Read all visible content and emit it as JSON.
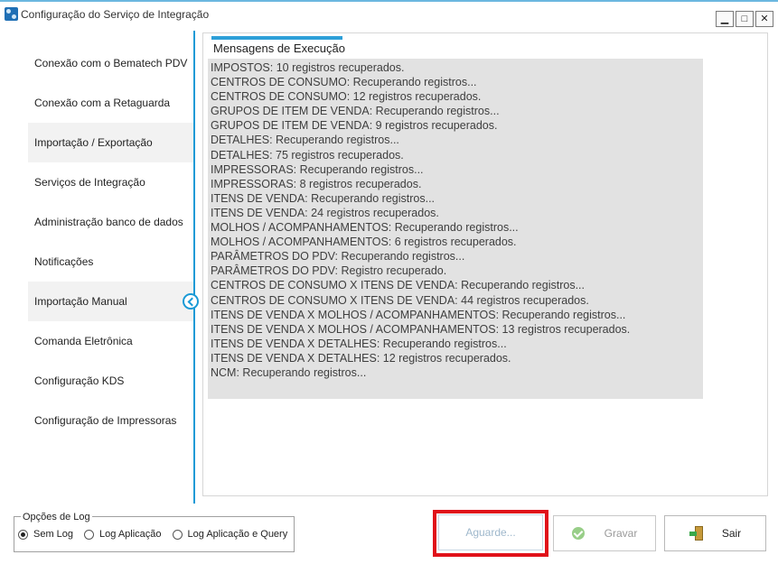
{
  "window": {
    "title": "Configuração do Serviço de Integração",
    "buttons": {
      "minimize": "▁",
      "maximize": "□",
      "close": "✕"
    }
  },
  "sidebar": {
    "items": [
      {
        "label": "Conexão com o Bematech PDV",
        "active": false
      },
      {
        "label": "Conexão com a Retaguarda",
        "active": false
      },
      {
        "label": "Importação / Exportação",
        "active": true
      },
      {
        "label": "Serviços de Integração",
        "active": false
      },
      {
        "label": "Administração banco de dados",
        "active": false
      },
      {
        "label": "Notificações",
        "active": false
      },
      {
        "label": "Importação Manual",
        "active": true
      },
      {
        "label": "Comanda Eletrônica",
        "active": false
      },
      {
        "label": "Configuração KDS",
        "active": false
      },
      {
        "label": "Configuração de Impressoras",
        "active": false
      }
    ]
  },
  "main": {
    "group_title": "Mensagens de Execução",
    "log_lines": [
      "IMPOSTOS: 10 registros recuperados.",
      "CENTROS DE CONSUMO: Recuperando registros...",
      "CENTROS DE CONSUMO: 12 registros recuperados.",
      "GRUPOS DE ITEM DE VENDA: Recuperando registros...",
      "GRUPOS DE ITEM DE VENDA: 9 registros recuperados.",
      "DETALHES: Recuperando registros...",
      "DETALHES: 75 registros recuperados.",
      "IMPRESSORAS: Recuperando registros...",
      "IMPRESSORAS: 8 registros recuperados.",
      "ITENS DE VENDA: Recuperando registros...",
      "ITENS DE VENDA: 24 registros recuperados.",
      "MOLHOS / ACOMPANHAMENTOS: Recuperando registros...",
      "MOLHOS / ACOMPANHAMENTOS: 6 registros recuperados.",
      "PARÂMETROS DO PDV: Recuperando registros...",
      "PARÂMETROS DO PDV: Registro recuperado.",
      "CENTROS DE CONSUMO X ITENS DE VENDA: Recuperando registros...",
      "CENTROS DE CONSUMO X ITENS DE VENDA: 44 registros recuperados.",
      "ITENS DE VENDA X MOLHOS / ACOMPANHAMENTOS: Recuperando registros...",
      "ITENS DE VENDA X MOLHOS / ACOMPANHAMENTOS: 13 registros recuperados.",
      "ITENS DE VENDA X DETALHES: Recuperando registros...",
      "ITENS DE VENDA X DETALHES: 12 registros recuperados.",
      "NCM: Recuperando registros..."
    ]
  },
  "log_options": {
    "label": "Opções de Log",
    "options": [
      {
        "label": "Sem Log",
        "checked": true
      },
      {
        "label": "Log Aplicação",
        "checked": false
      },
      {
        "label": "Log Aplicação e Query",
        "checked": false
      }
    ]
  },
  "footer": {
    "wait_label": "Aguarde...",
    "save_label": "Gravar",
    "exit_label": "Sair"
  },
  "colors": {
    "accent": "#1a9ad6",
    "highlight": "#e0121a",
    "log_background": "#e2e2e2"
  }
}
